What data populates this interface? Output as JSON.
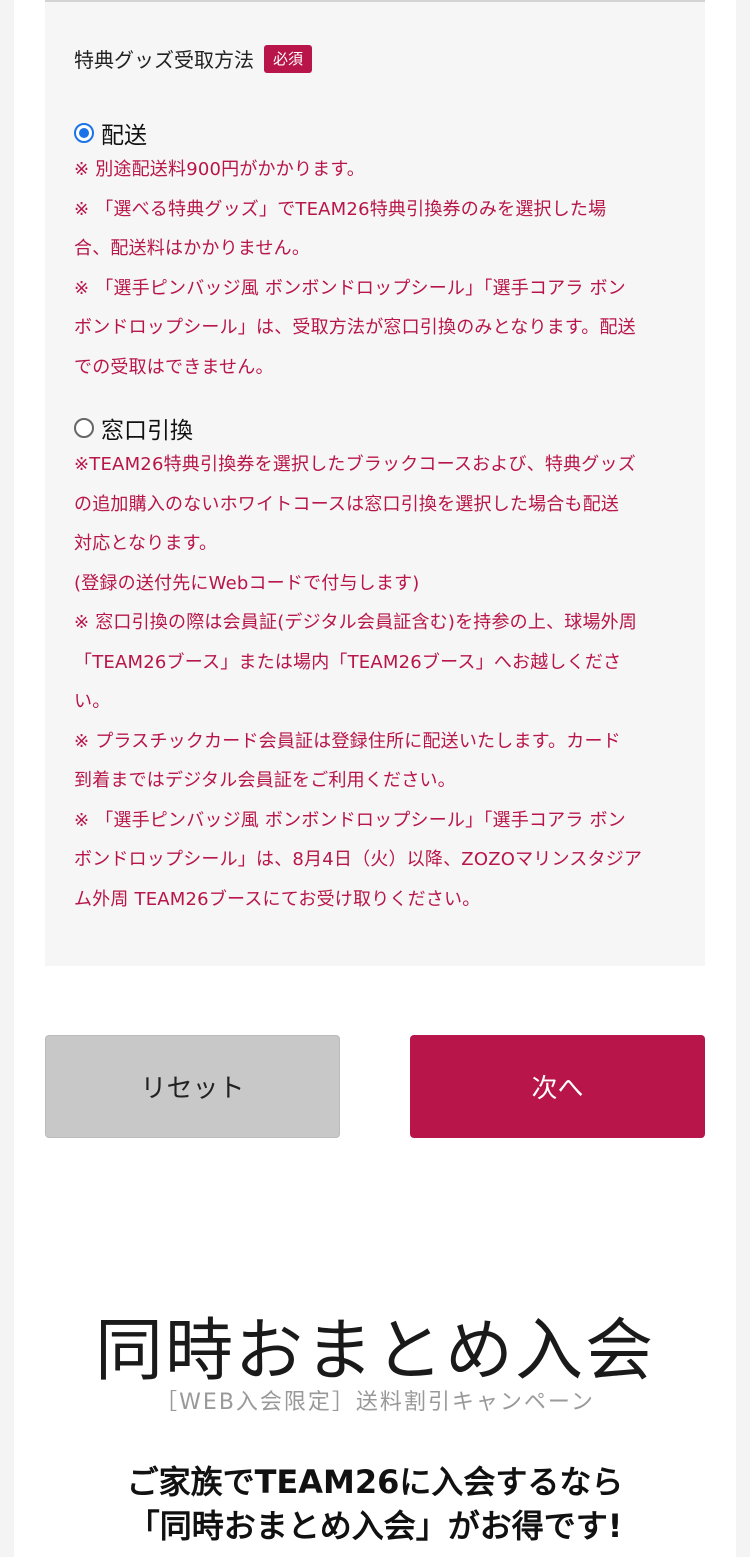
{
  "form": {
    "field_label": "特典グッズ受取方法",
    "required_badge": "必須",
    "options": [
      {
        "label": "配送",
        "checked": true,
        "notes": [
          "※ 別途配送料900円がかかります。",
          "※ 「選べる特典グッズ」でTEAM26特典引換券のみを選択した場",
          "合、配送料はかかりません。",
          "※ 「選手ピンバッジ風 ボンボンドロップシール」「選手コアラ ボン",
          "ボンドロップシール」は、受取方法が窓口引換のみとなります。配送",
          "での受取はできません。"
        ]
      },
      {
        "label": "窓口引換",
        "checked": false,
        "notes": [
          "※TEAM26特典引換券を選択したブラックコースおよび、特典グッズ",
          "の追加購入のないホワイトコースは窓口引換を選択した場合も配送",
          "対応となります。",
          "(登録の送付先にWebコードで付与します)",
          "※ 窓口引換の際は会員証(デジタル会員証含む)を持参の上、球場外周",
          "「TEAM26ブース」または場内「TEAM26ブース」へお越しくださ",
          "い。",
          "※ プラスチックカード会員証は登録住所に配送いたします。カード",
          "到着まではデジタル会員証をご利用ください。",
          "※ 「選手ピンバッジ風 ボンボンドロップシール」「選手コアラ ボン",
          "ボンドロップシール」は、8月4日（火）以降、ZOZOマリンスタジア",
          "ム外周 TEAM26ブースにてお受け取りください。"
        ]
      }
    ]
  },
  "buttons": {
    "reset": "リセット",
    "next": "次へ"
  },
  "promo": {
    "title": "同時おまとめ入会",
    "subtitle": "［WEB入会限定］送料割引キャンペーン",
    "heading_line1": "ご家族でTEAM26に入会するなら",
    "heading_line2": "「同時おまとめ入会」がお得です!"
  },
  "colors": {
    "accent": "#b8164a",
    "radio_selected": "#1a73e8"
  }
}
